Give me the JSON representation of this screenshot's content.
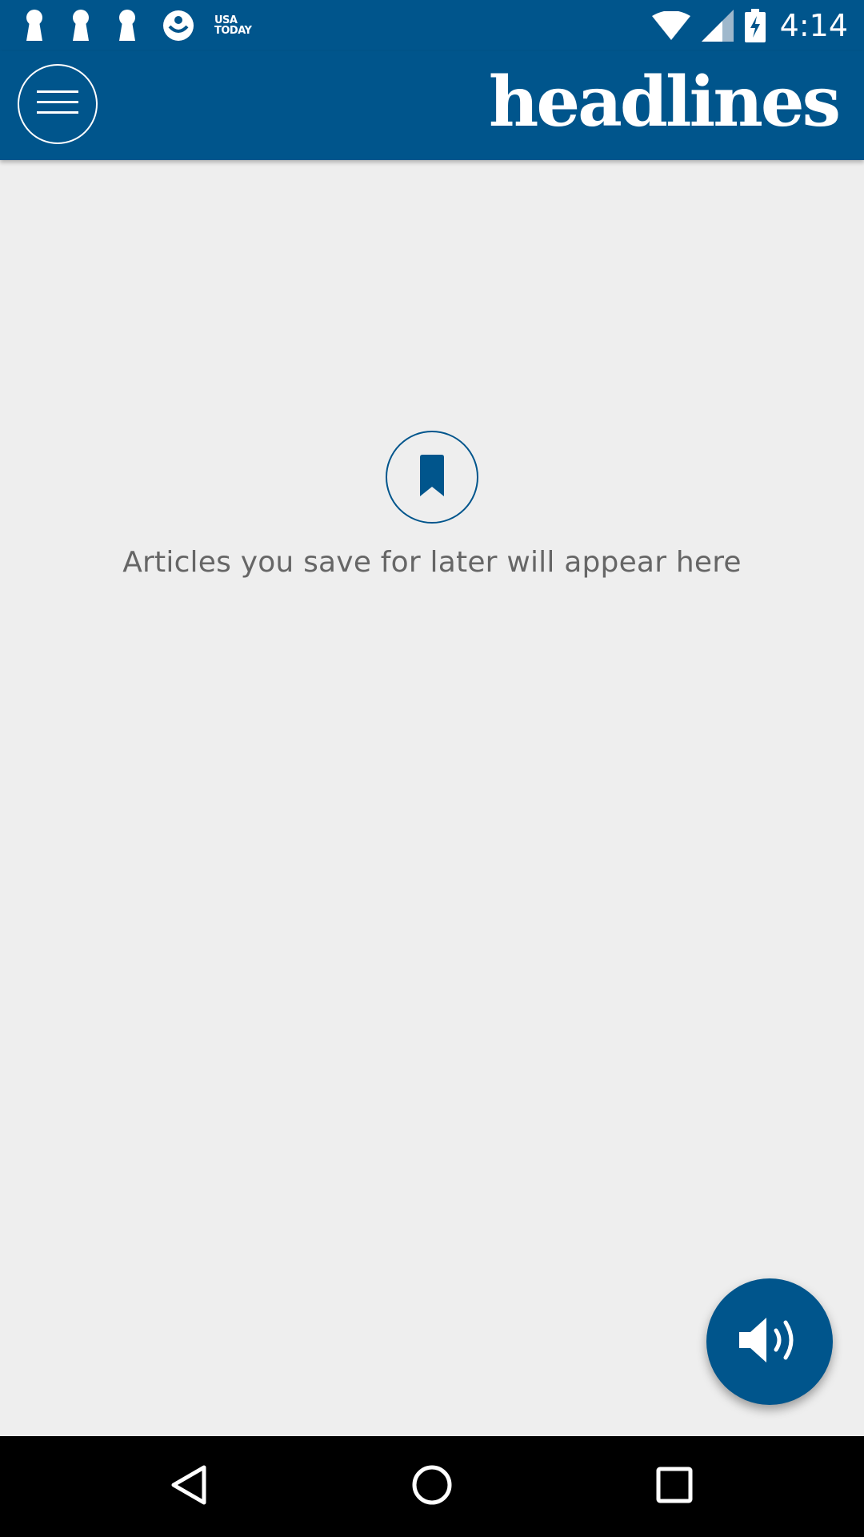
{
  "status_bar": {
    "time": "4:14",
    "usa_today_line1": "USA",
    "usa_today_line2": "TODAY",
    "left_icons": [
      "keyhole-icon",
      "keyhole-icon",
      "keyhole-icon",
      "usa-today-app-icon"
    ],
    "right_icons": [
      "wifi-icon",
      "cell-signal-icon",
      "battery-charging-icon"
    ]
  },
  "app_bar": {
    "title": "headlines",
    "menu_icon": "hamburger-menu-icon"
  },
  "empty_state": {
    "icon": "bookmark-icon",
    "message": "Articles you save for later will appear here"
  },
  "fab": {
    "icon": "speaker-icon"
  },
  "nav_bar": {
    "icons": [
      "back-icon",
      "home-icon",
      "recents-icon"
    ]
  },
  "colors": {
    "brand": "#00558c",
    "background": "#eeeeee",
    "text_muted": "#666666",
    "nav_background": "#000000"
  }
}
